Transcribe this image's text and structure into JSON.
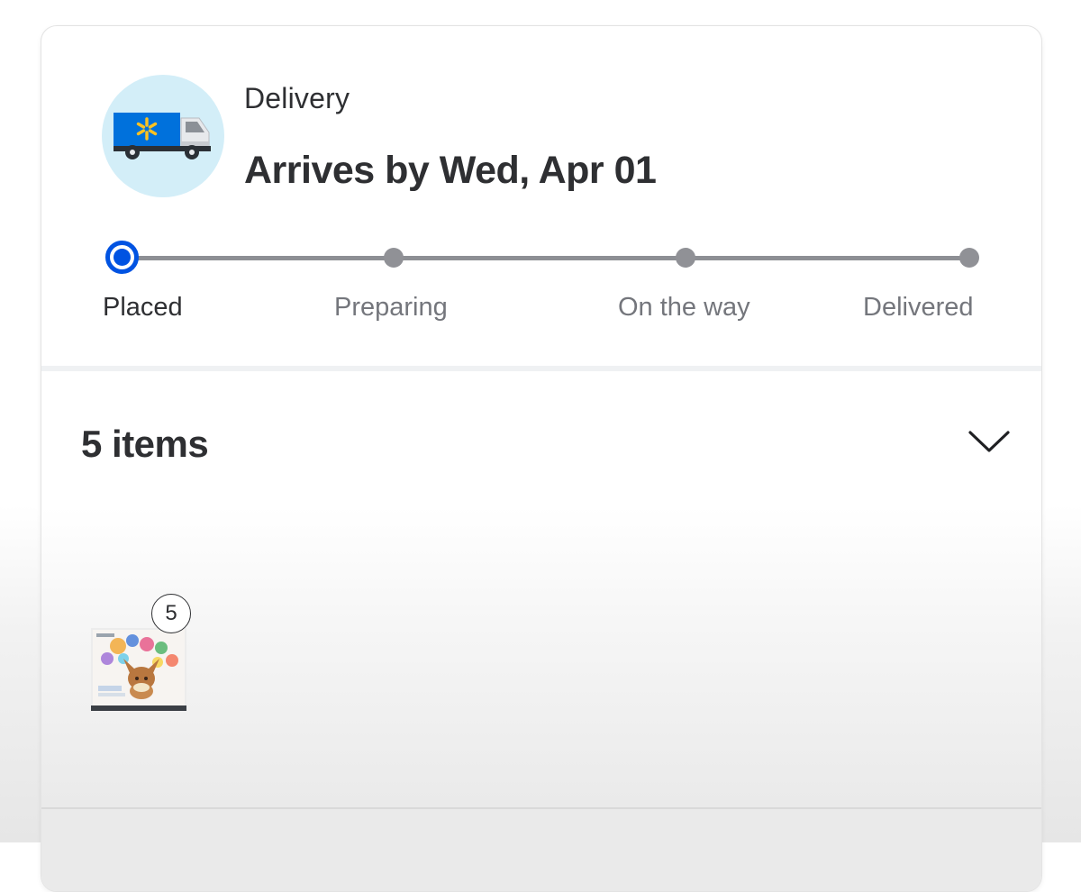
{
  "delivery": {
    "type_label": "Delivery",
    "arrival_text": "Arrives by Wed, Apr 01",
    "icon": "walmart-delivery-truck-icon"
  },
  "tracker": {
    "current_step": "Placed",
    "steps": [
      {
        "label": "Placed",
        "state": "current"
      },
      {
        "label": "Preparing",
        "state": "upcoming"
      },
      {
        "label": "On the way",
        "state": "upcoming"
      },
      {
        "label": "Delivered",
        "state": "upcoming"
      }
    ]
  },
  "items": {
    "title": "5 items",
    "expand_icon": "chevron-down-icon",
    "products": [
      {
        "quantity": "5",
        "image": "pokemon-eevee-collection-box"
      }
    ]
  },
  "colors": {
    "accent": "#0053e2",
    "truck_blue": "#0071dc",
    "spark_yellow": "#ffc220",
    "icon_background": "#d3eef8",
    "text_primary": "#2e2f32",
    "text_secondary": "#74767c",
    "tracker_gray": "#8d8f94"
  }
}
